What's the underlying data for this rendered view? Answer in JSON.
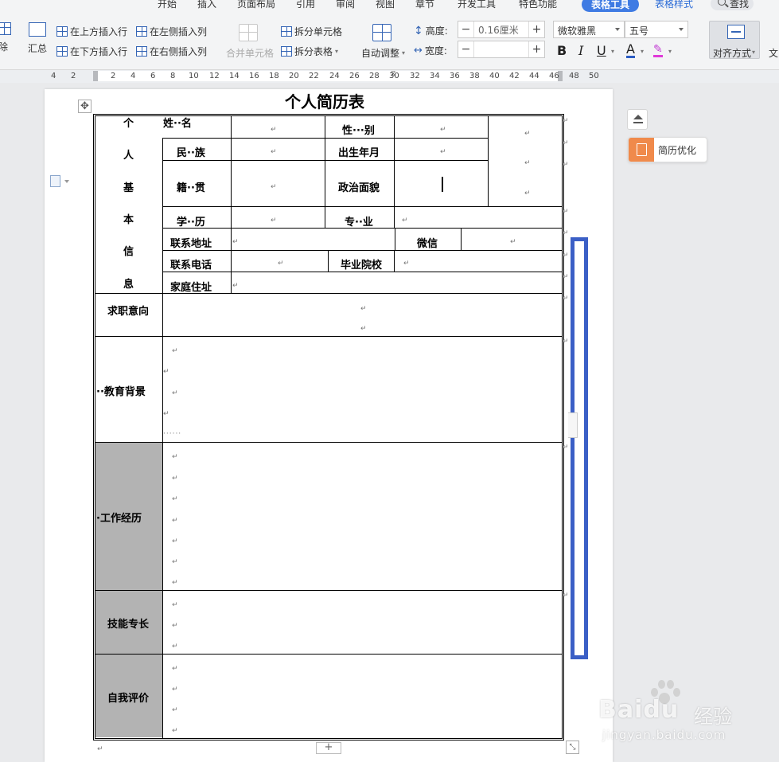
{
  "tabs": {
    "start": "开始",
    "insert": "插入",
    "layout": "页面布局",
    "reference": "引用",
    "review": "审阅",
    "view": "视图",
    "chapter": "章节",
    "devtools": "开发工具",
    "special": "特色功能",
    "table_tools": "表格工具",
    "table_style": "表格样式",
    "search": "查找"
  },
  "toolbar": {
    "delete": "除",
    "summary": "汇总",
    "insert_above": "在上方插入行",
    "insert_below": "在下方插入行",
    "insert_left": "在左侧插入列",
    "insert_right": "在右侧插入列",
    "merge_cells": "合并单元格",
    "split_cells": "拆分单元格",
    "split_table": "拆分表格",
    "auto_fit": "自动调整",
    "height_label": "高度:",
    "height_value": "0.16厘米",
    "width_label": "宽度:",
    "width_value": "",
    "font_name": "微软雅黑",
    "font_size": "五号",
    "bold": "B",
    "italic": "I",
    "underline": "U",
    "font_color": "A",
    "align": "对齐方式",
    "text_dir": "文"
  },
  "ruler": {
    "numbers": [
      "4",
      "2",
      "2",
      "4",
      "6",
      "8",
      "10",
      "12",
      "14",
      "16",
      "18",
      "20",
      "22",
      "24",
      "26",
      "28",
      "30",
      "32",
      "34",
      "36",
      "38",
      "40",
      "42",
      "44",
      "46",
      "48",
      "50"
    ]
  },
  "document": {
    "title": "个人简历表",
    "basic_info_vertical": [
      "个",
      "人",
      "基",
      "本",
      "信",
      "息"
    ],
    "labels": {
      "name": "姓··名",
      "gender": "性···别",
      "ethnic": "民··族",
      "birth": "出生年月",
      "origin": "籍··贯",
      "politics": "政治面貌",
      "education_level": "学··历",
      "major": "专··业",
      "address": "联系地址",
      "wechat": "微信",
      "phone": "联系电话",
      "school": "毕业院校",
      "home": "家庭住址",
      "job_intent": "求职意向",
      "edu_background": "··教育背景",
      "work_exp": "·工作经历",
      "skills": "技能专长",
      "self_eval": "自我评价"
    },
    "paragraph_mark": "↵",
    "dots": "······"
  },
  "side_panel": {
    "optimize": "简历优化"
  },
  "watermark": {
    "brand": "Baidu",
    "jingyan": "经验",
    "url": "jingyan.baidu.com"
  },
  "colors": {
    "accent": "#3f7be3",
    "shade": "#b3b3b3",
    "highlight_bar": "#3b5fc6",
    "optimize_icon": "#f08a4b"
  }
}
